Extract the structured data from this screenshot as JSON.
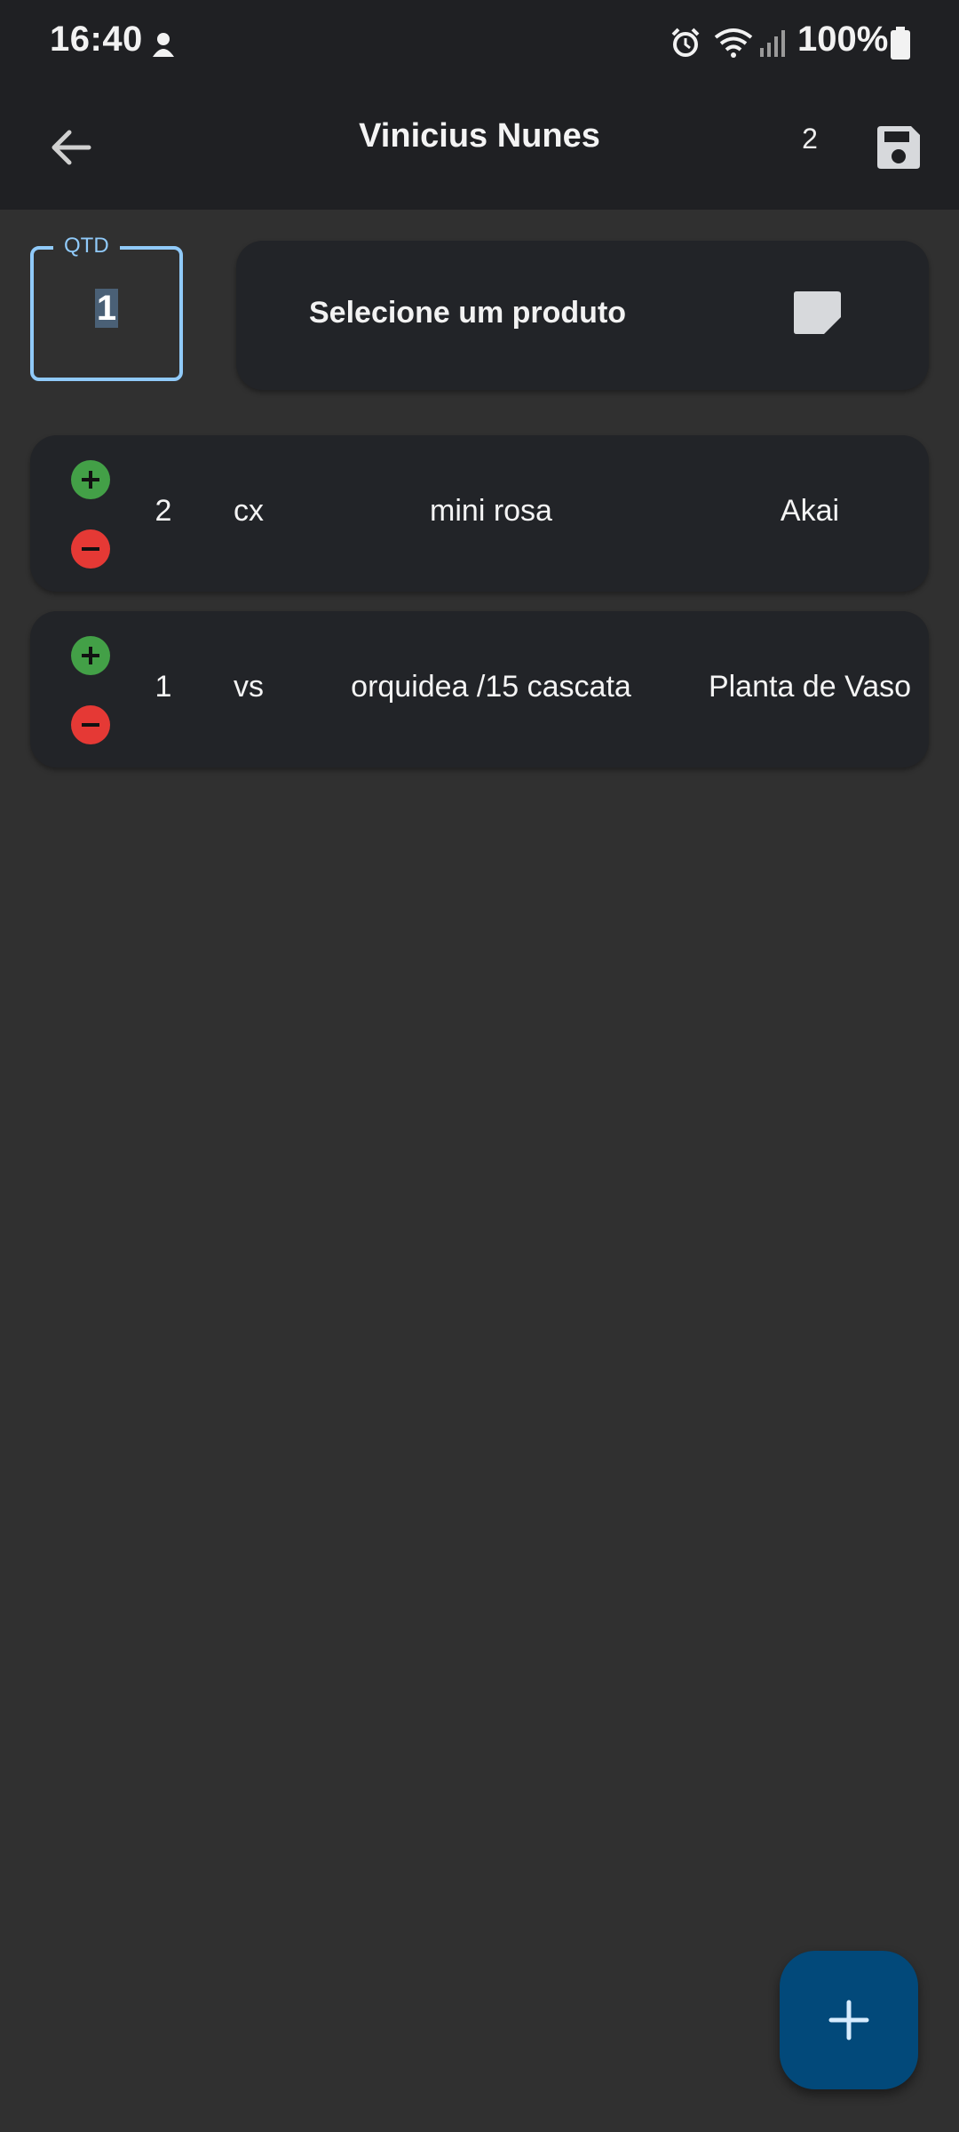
{
  "status_bar": {
    "time": "16:40",
    "battery": "100%",
    "icons": [
      "notification-icon",
      "alarm-icon",
      "wifi-icon",
      "signal-icon",
      "battery-icon"
    ]
  },
  "header": {
    "title": "Vinicius Nunes",
    "count": "2",
    "back_icon": "arrow-left-icon",
    "save_icon": "save-icon"
  },
  "form": {
    "qtd_label": "QTD",
    "qtd_value": "1",
    "product_placeholder": "Selecione um produto",
    "product_icon": "note-icon"
  },
  "items": [
    {
      "qty": "2",
      "unit": "cx",
      "name": "mini rosa",
      "category": "Akai"
    },
    {
      "qty": "1",
      "unit": "vs",
      "name": "orquidea /15 cascata",
      "category": "Planta de Vaso"
    }
  ],
  "colors": {
    "accent": "#90caf9",
    "plus": "#43a047",
    "minus": "#e53935",
    "fab": "#02497a",
    "background": "#303030",
    "bar": "#1f2023",
    "card": "#222428"
  },
  "fab_icon": "plus-icon"
}
